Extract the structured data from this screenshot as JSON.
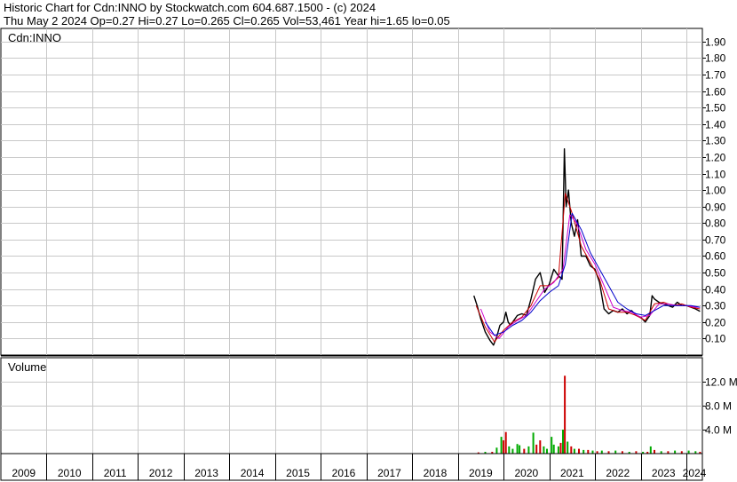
{
  "header": {
    "line1": "Historic Chart for Cdn:INNO by Stockwatch.com 604.687.1500 - (c) 2024",
    "line2": "Thu May  2 2024  Op=0.27  Hi=0.27  Lo=0.265  Cl=0.265  Vol=53,461  Year hi=1.65  lo=0.05"
  },
  "chart_data": [
    {
      "type": "line",
      "title": "Cdn:INNO",
      "y_axis_side": "right",
      "ylim": [
        0.0,
        1.98
      ],
      "y_ticks": [
        "0.10",
        "0.20",
        "0.30",
        "0.40",
        "0.50",
        "0.60",
        "0.70",
        "0.80",
        "0.90",
        "1.00",
        "1.10",
        "1.20",
        "1.30",
        "1.40",
        "1.50",
        "1.60",
        "1.70",
        "1.80",
        "1.90"
      ],
      "grid": true,
      "x_categories": [
        "2009",
        "2010",
        "2011",
        "2012",
        "2013",
        "2014",
        "2015",
        "2016",
        "2017",
        "2018",
        "2019",
        "2020",
        "2021",
        "2022",
        "2023",
        "2024"
      ],
      "x_range": [
        2009.0,
        2024.35
      ],
      "colors": {
        "price": "#000000",
        "ma_short": "#cc0000",
        "ma_mid": "#cc00cc",
        "ma_long": "#0000cc"
      },
      "series": [
        {
          "x": [
            2019.35,
            2019.42,
            2019.5,
            2019.6,
            2019.7,
            2019.78,
            2019.85,
            2019.92,
            2020.0,
            2020.05,
            2020.1,
            2020.15,
            2020.2,
            2020.3,
            2020.4,
            2020.5,
            2020.6,
            2020.7,
            2020.8,
            2020.9,
            2021.0,
            2021.1,
            2021.2,
            2021.28,
            2021.33,
            2021.37,
            2021.42,
            2021.48,
            2021.55,
            2021.62,
            2021.7,
            2021.8,
            2021.9,
            2022.0,
            2022.1,
            2022.2,
            2022.3,
            2022.4,
            2022.5,
            2022.6,
            2022.7,
            2022.8,
            2022.9,
            2023.0,
            2023.1,
            2023.2,
            2023.25,
            2023.3,
            2023.4,
            2023.5,
            2023.6,
            2023.7,
            2023.8,
            2023.9,
            2024.0,
            2024.1,
            2024.2,
            2024.3
          ],
          "y": [
            0.36,
            0.3,
            0.22,
            0.14,
            0.09,
            0.06,
            0.11,
            0.18,
            0.2,
            0.26,
            0.2,
            0.18,
            0.2,
            0.24,
            0.25,
            0.24,
            0.34,
            0.46,
            0.5,
            0.38,
            0.43,
            0.52,
            0.48,
            0.46,
            1.25,
            0.9,
            1.0,
            0.8,
            0.72,
            0.82,
            0.6,
            0.6,
            0.54,
            0.52,
            0.44,
            0.28,
            0.25,
            0.27,
            0.26,
            0.28,
            0.25,
            0.27,
            0.24,
            0.23,
            0.2,
            0.24,
            0.36,
            0.34,
            0.32,
            0.31,
            0.3,
            0.29,
            0.32,
            0.3,
            0.3,
            0.29,
            0.28,
            0.265
          ]
        },
        {
          "x": [
            2019.4,
            2019.6,
            2019.8,
            2020.0,
            2020.2,
            2020.4,
            2020.6,
            2020.8,
            2021.0,
            2021.2,
            2021.35,
            2021.5,
            2021.7,
            2021.9,
            2022.1,
            2022.3,
            2022.5,
            2022.7,
            2022.9,
            2023.1,
            2023.3,
            2023.5,
            2023.7,
            2023.9,
            2024.1,
            2024.3
          ],
          "y": [
            0.3,
            0.17,
            0.08,
            0.15,
            0.2,
            0.23,
            0.3,
            0.42,
            0.42,
            0.47,
            0.98,
            0.86,
            0.66,
            0.56,
            0.46,
            0.28,
            0.26,
            0.26,
            0.24,
            0.21,
            0.31,
            0.32,
            0.3,
            0.31,
            0.29,
            0.28
          ]
        },
        {
          "x": [
            2019.5,
            2019.7,
            2019.9,
            2020.1,
            2020.3,
            2020.5,
            2020.7,
            2020.9,
            2021.1,
            2021.3,
            2021.45,
            2021.6,
            2021.8,
            2022.0,
            2022.2,
            2022.4,
            2022.6,
            2022.8,
            2023.0,
            2023.2,
            2023.4,
            2023.6,
            2023.8,
            2024.0,
            2024.2,
            2024.3
          ],
          "y": [
            0.28,
            0.14,
            0.1,
            0.17,
            0.21,
            0.24,
            0.32,
            0.4,
            0.44,
            0.52,
            0.85,
            0.8,
            0.64,
            0.55,
            0.42,
            0.29,
            0.27,
            0.26,
            0.23,
            0.24,
            0.31,
            0.31,
            0.3,
            0.3,
            0.29,
            0.29
          ]
        },
        {
          "x": [
            2019.6,
            2019.8,
            2020.0,
            2020.2,
            2020.4,
            2020.6,
            2020.8,
            2021.0,
            2021.2,
            2021.35,
            2021.5,
            2021.7,
            2021.9,
            2022.1,
            2022.3,
            2022.5,
            2022.7,
            2022.9,
            2023.1,
            2023.3,
            2023.5,
            2023.7,
            2023.9,
            2024.1,
            2024.3
          ],
          "y": [
            0.2,
            0.12,
            0.14,
            0.18,
            0.21,
            0.26,
            0.33,
            0.38,
            0.42,
            0.55,
            0.86,
            0.76,
            0.62,
            0.52,
            0.42,
            0.32,
            0.28,
            0.25,
            0.24,
            0.27,
            0.3,
            0.3,
            0.3,
            0.3,
            0.29
          ]
        }
      ]
    },
    {
      "type": "bar",
      "title": "Volume",
      "y_axis_side": "right",
      "ylim": [
        0,
        16
      ],
      "y_ticks": [
        "4.0 M",
        "8.0 M",
        "12.0 M"
      ],
      "grid": true,
      "colors": {
        "up": "#00aa00",
        "down": "#cc0000"
      },
      "bars": [
        {
          "x": 2019.45,
          "v": 0.2,
          "c": "down"
        },
        {
          "x": 2019.6,
          "v": 0.3,
          "c": "up"
        },
        {
          "x": 2019.75,
          "v": 0.3,
          "c": "down"
        },
        {
          "x": 2019.85,
          "v": 1.0,
          "c": "up"
        },
        {
          "x": 2019.95,
          "v": 2.8,
          "c": "up"
        },
        {
          "x": 2020.0,
          "v": 2.2,
          "c": "down"
        },
        {
          "x": 2020.05,
          "v": 3.6,
          "c": "down"
        },
        {
          "x": 2020.12,
          "v": 1.2,
          "c": "up"
        },
        {
          "x": 2020.2,
          "v": 0.8,
          "c": "up"
        },
        {
          "x": 2020.3,
          "v": 1.6,
          "c": "up"
        },
        {
          "x": 2020.35,
          "v": 1.4,
          "c": "up"
        },
        {
          "x": 2020.45,
          "v": 0.8,
          "c": "down"
        },
        {
          "x": 2020.55,
          "v": 1.2,
          "c": "up"
        },
        {
          "x": 2020.65,
          "v": 3.5,
          "c": "up"
        },
        {
          "x": 2020.72,
          "v": 1.5,
          "c": "down"
        },
        {
          "x": 2020.8,
          "v": 2.2,
          "c": "down"
        },
        {
          "x": 2020.88,
          "v": 1.2,
          "c": "up"
        },
        {
          "x": 2020.95,
          "v": 0.8,
          "c": "up"
        },
        {
          "x": 2021.05,
          "v": 2.8,
          "c": "up"
        },
        {
          "x": 2021.1,
          "v": 1.5,
          "c": "up"
        },
        {
          "x": 2021.2,
          "v": 1.2,
          "c": "up"
        },
        {
          "x": 2021.25,
          "v": 1.8,
          "c": "down"
        },
        {
          "x": 2021.3,
          "v": 4.0,
          "c": "up"
        },
        {
          "x": 2021.34,
          "v": 13.0,
          "c": "down"
        },
        {
          "x": 2021.4,
          "v": 2.0,
          "c": "up"
        },
        {
          "x": 2021.48,
          "v": 1.2,
          "c": "down"
        },
        {
          "x": 2021.55,
          "v": 0.8,
          "c": "up"
        },
        {
          "x": 2021.65,
          "v": 0.8,
          "c": "down"
        },
        {
          "x": 2021.75,
          "v": 0.6,
          "c": "up"
        },
        {
          "x": 2021.85,
          "v": 0.6,
          "c": "down"
        },
        {
          "x": 2021.95,
          "v": 0.5,
          "c": "up"
        },
        {
          "x": 2022.05,
          "v": 0.4,
          "c": "down"
        },
        {
          "x": 2022.15,
          "v": 0.5,
          "c": "up"
        },
        {
          "x": 2022.3,
          "v": 0.4,
          "c": "down"
        },
        {
          "x": 2022.45,
          "v": 0.5,
          "c": "up"
        },
        {
          "x": 2022.6,
          "v": 0.4,
          "c": "down"
        },
        {
          "x": 2022.75,
          "v": 0.3,
          "c": "up"
        },
        {
          "x": 2022.9,
          "v": 0.4,
          "c": "down"
        },
        {
          "x": 2023.05,
          "v": 0.3,
          "c": "up"
        },
        {
          "x": 2023.15,
          "v": 0.3,
          "c": "down"
        },
        {
          "x": 2023.22,
          "v": 1.2,
          "c": "up"
        },
        {
          "x": 2023.3,
          "v": 0.6,
          "c": "down"
        },
        {
          "x": 2023.45,
          "v": 0.4,
          "c": "up"
        },
        {
          "x": 2023.6,
          "v": 0.4,
          "c": "down"
        },
        {
          "x": 2023.75,
          "v": 0.5,
          "c": "up"
        },
        {
          "x": 2023.9,
          "v": 0.4,
          "c": "down"
        },
        {
          "x": 2024.05,
          "v": 0.5,
          "c": "up"
        },
        {
          "x": 2024.2,
          "v": 0.4,
          "c": "up"
        },
        {
          "x": 2024.3,
          "v": 0.3,
          "c": "down"
        }
      ]
    }
  ]
}
